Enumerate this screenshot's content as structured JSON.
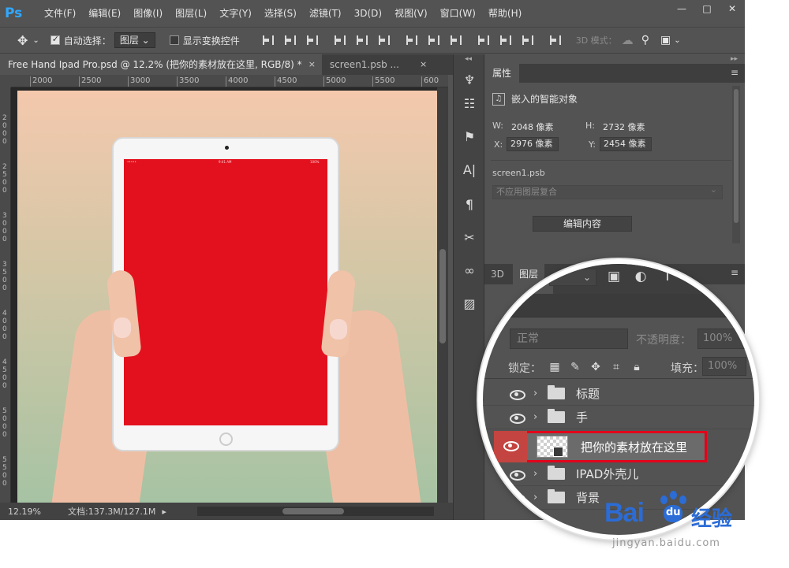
{
  "app": {
    "logo": "Ps",
    "menu": [
      "文件(F)",
      "编辑(E)",
      "图像(I)",
      "图层(L)",
      "文字(Y)",
      "选择(S)",
      "滤镜(T)",
      "3D(D)",
      "视图(V)",
      "窗口(W)",
      "帮助(H)"
    ],
    "window_controls": {
      "minimize": "—",
      "restore": "□",
      "close": "✕"
    }
  },
  "options": {
    "auto_select_label": "自动选择：",
    "auto_select_checked": true,
    "auto_select_target": "图层",
    "show_transform_label": "显示变换控件",
    "show_transform_checked": false,
    "mode_3d": "3D 模式："
  },
  "tabs": [
    {
      "label": "Free Hand Ipad Pro.psd @ 12.2% (把你的素材放在这里, RGB/8) *",
      "close": "×",
      "active": true
    },
    {
      "label": "screen1.psb ...",
      "close": "×",
      "active": false
    }
  ],
  "ruler": {
    "top_ticks": [
      "2000",
      "2500",
      "3000",
      "3500",
      "4000",
      "4500",
      "5000",
      "5500",
      "600"
    ],
    "left_ticks": [
      "2",
      "0",
      "0",
      "0",
      "2",
      "5",
      "0",
      "0",
      "3",
      "0",
      "0",
      "0",
      "3",
      "5",
      "0",
      "0",
      "4",
      "0",
      "0",
      "0",
      "4",
      "5",
      "0",
      "0",
      "5",
      "0",
      "0",
      "0",
      "5",
      "5",
      "0",
      "0"
    ]
  },
  "canvas": {
    "ipad_time": "9:41 AM",
    "ipad_battery": "100%",
    "screen_color": "#e3111e"
  },
  "status": {
    "zoom": "12.19%",
    "doc_info": "文档:137.3M/127.1M",
    "arrow": "▸"
  },
  "properties": {
    "tab": "属性",
    "menu": "≡",
    "type": "嵌入的智能对象",
    "w_label": "W:",
    "w_value": "2048 像素",
    "h_label": "H:",
    "h_value": "2732 像素",
    "x_label": "X:",
    "x_value": "2976 像素",
    "y_label": "Y:",
    "y_value": "2454 像素",
    "source": "screen1.psb",
    "comp": "不应用图层复合",
    "edit_button": "编辑内容"
  },
  "layers": {
    "tab_3d": "3D",
    "tab_layers": "图层",
    "menu": "≡",
    "search_placeholder": "类",
    "blend_mode": "正常",
    "opacity_label": "不透明度：",
    "opacity_value": "100%",
    "lock_label": "锁定：",
    "fill_label": "填充：",
    "fill_value": "100%",
    "items": [
      {
        "name": "标题",
        "type": "group"
      },
      {
        "name": "手",
        "type": "group"
      },
      {
        "name": "把你的素材放在这里",
        "type": "smart-object",
        "selected": true
      },
      {
        "name": "IPAD外壳儿",
        "type": "group"
      },
      {
        "name": "背景",
        "type": "group"
      }
    ]
  },
  "watermark": {
    "logo": "Bai",
    "logo_suffix": "du",
    "cn": "经验",
    "url": "jingyan.baidu.com"
  },
  "colors": {
    "ui_bg": "#535353",
    "ps_blue": "#31a8ff",
    "highlight_red": "#e2001a",
    "baidu_blue": "#2b6cd6"
  }
}
